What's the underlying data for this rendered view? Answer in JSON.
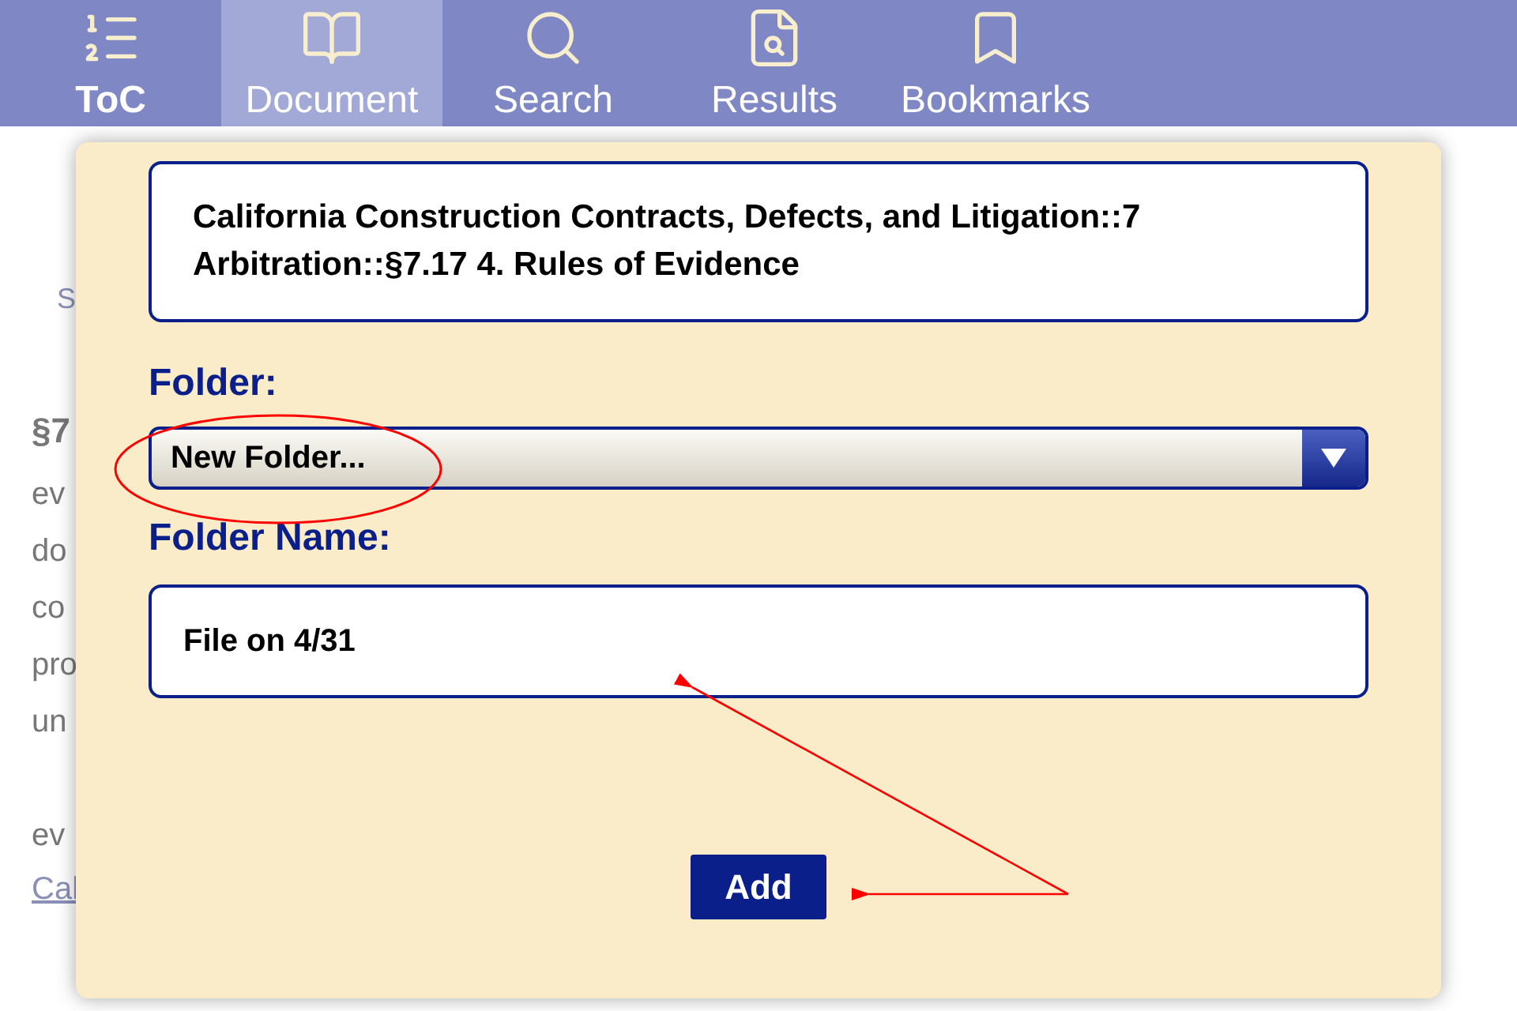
{
  "tabs": [
    {
      "label": "ToC",
      "kind": "list",
      "selected": false
    },
    {
      "label": "Document",
      "kind": "book",
      "selected": true
    },
    {
      "label": "Search",
      "kind": "search",
      "selected": false
    },
    {
      "label": "Results",
      "kind": "results",
      "selected": false
    },
    {
      "label": "Bookmarks",
      "kind": "bookmark",
      "selected": false
    }
  ],
  "background_text": [
    {
      "text": "S",
      "kind": "subtitle"
    },
    {
      "text": "§7",
      "kind": "heading"
    },
    {
      "text": "ev",
      "kind": "body"
    },
    {
      "text": "do",
      "kind": "body"
    },
    {
      "text": "co",
      "kind": "body"
    },
    {
      "text": "pro",
      "kind": "body"
    },
    {
      "text": "un",
      "kind": "body"
    },
    {
      "text": "ev",
      "kind": "gap"
    },
    {
      "text": "Cal",
      "kind": "link"
    }
  ],
  "dialog": {
    "bookmark_title": "California Construction Contracts, Defects, and Litigation::7 Arbitration::§7.17 4. Rules of Evidence",
    "folder_label": "Folder:",
    "folder_value": "New Folder...",
    "folder_name_label": "Folder Name:",
    "folder_name_value": "File on 4/31",
    "button": "Add"
  }
}
